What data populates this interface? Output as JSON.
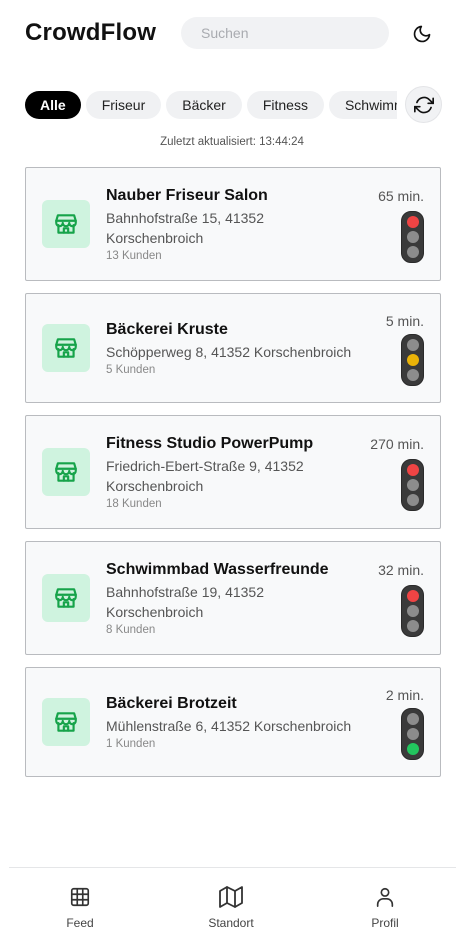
{
  "header": {
    "title": "CrowdFlow",
    "search_placeholder": "Suchen",
    "theme_icon": "moon-icon"
  },
  "filters": {
    "chips": [
      {
        "label": "Alle",
        "active": true
      },
      {
        "label": "Friseur",
        "active": false
      },
      {
        "label": "Bäcker",
        "active": false
      },
      {
        "label": "Fitness",
        "active": false
      },
      {
        "label": "Schwimmbad",
        "active": false
      }
    ],
    "refresh_icon": "refresh-icon"
  },
  "updated_text": "Zuletzt aktualisiert: 13:44:24",
  "places": [
    {
      "name": "Nauber Friseur Salon",
      "address": "Bahnhofstraße 15, 41352 Korschenbroich",
      "customers": "13 Kunden",
      "wait": "65 min.",
      "status": "red"
    },
    {
      "name": "Bäckerei Kruste",
      "address": "Schöpperweg 8, 41352 Korschenbroich",
      "customers": "5 Kunden",
      "wait": "5 min.",
      "status": "yellow"
    },
    {
      "name": "Fitness Studio PowerPump",
      "address": "Friedrich-Ebert-Straße 9, 41352 Korschenbroich",
      "customers": "18 Kunden",
      "wait": "270 min.",
      "status": "red"
    },
    {
      "name": "Schwimmbad Wasserfreunde",
      "address": "Bahnhofstraße 19, 41352 Korschenbroich",
      "customers": "8 Kunden",
      "wait": "32 min.",
      "status": "red"
    },
    {
      "name": "Bäckerei Brotzeit",
      "address": "Mühlenstraße 6, 41352 Korschenbroich",
      "customers": "1 Kunden",
      "wait": "2 min.",
      "status": "green"
    }
  ],
  "colors": {
    "red": "#ef4444",
    "yellow": "#eab308",
    "green": "#22c55e",
    "off": "#8c8c8c",
    "store_icon": "#16a34a"
  },
  "nav": {
    "items": [
      {
        "label": "Feed",
        "icon": "grid-icon"
      },
      {
        "label": "Standort",
        "icon": "map-icon"
      },
      {
        "label": "Profil",
        "icon": "user-icon"
      }
    ]
  }
}
